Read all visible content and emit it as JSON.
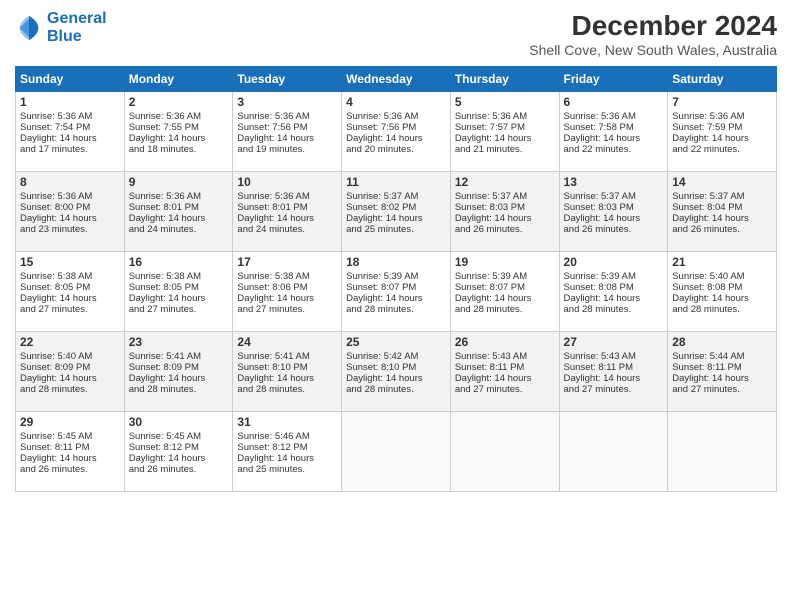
{
  "logo": {
    "line1": "General",
    "line2": "Blue"
  },
  "title": "December 2024",
  "subtitle": "Shell Cove, New South Wales, Australia",
  "headers": [
    "Sunday",
    "Monday",
    "Tuesday",
    "Wednesday",
    "Thursday",
    "Friday",
    "Saturday"
  ],
  "weeks": [
    [
      {
        "day": "1",
        "sunrise": "5:36 AM",
        "sunset": "7:54 PM",
        "daylight": "14 hours and 17 minutes."
      },
      {
        "day": "2",
        "sunrise": "5:36 AM",
        "sunset": "7:55 PM",
        "daylight": "14 hours and 18 minutes."
      },
      {
        "day": "3",
        "sunrise": "5:36 AM",
        "sunset": "7:56 PM",
        "daylight": "14 hours and 19 minutes."
      },
      {
        "day": "4",
        "sunrise": "5:36 AM",
        "sunset": "7:56 PM",
        "daylight": "14 hours and 20 minutes."
      },
      {
        "day": "5",
        "sunrise": "5:36 AM",
        "sunset": "7:57 PM",
        "daylight": "14 hours and 21 minutes."
      },
      {
        "day": "6",
        "sunrise": "5:36 AM",
        "sunset": "7:58 PM",
        "daylight": "14 hours and 22 minutes."
      },
      {
        "day": "7",
        "sunrise": "5:36 AM",
        "sunset": "7:59 PM",
        "daylight": "14 hours and 22 minutes."
      }
    ],
    [
      {
        "day": "8",
        "sunrise": "5:36 AM",
        "sunset": "8:00 PM",
        "daylight": "14 hours and 23 minutes."
      },
      {
        "day": "9",
        "sunrise": "5:36 AM",
        "sunset": "8:01 PM",
        "daylight": "14 hours and 24 minutes."
      },
      {
        "day": "10",
        "sunrise": "5:36 AM",
        "sunset": "8:01 PM",
        "daylight": "14 hours and 24 minutes."
      },
      {
        "day": "11",
        "sunrise": "5:37 AM",
        "sunset": "8:02 PM",
        "daylight": "14 hours and 25 minutes."
      },
      {
        "day": "12",
        "sunrise": "5:37 AM",
        "sunset": "8:03 PM",
        "daylight": "14 hours and 26 minutes."
      },
      {
        "day": "13",
        "sunrise": "5:37 AM",
        "sunset": "8:03 PM",
        "daylight": "14 hours and 26 minutes."
      },
      {
        "day": "14",
        "sunrise": "5:37 AM",
        "sunset": "8:04 PM",
        "daylight": "14 hours and 26 minutes."
      }
    ],
    [
      {
        "day": "15",
        "sunrise": "5:38 AM",
        "sunset": "8:05 PM",
        "daylight": "14 hours and 27 minutes."
      },
      {
        "day": "16",
        "sunrise": "5:38 AM",
        "sunset": "8:05 PM",
        "daylight": "14 hours and 27 minutes."
      },
      {
        "day": "17",
        "sunrise": "5:38 AM",
        "sunset": "8:06 PM",
        "daylight": "14 hours and 27 minutes."
      },
      {
        "day": "18",
        "sunrise": "5:39 AM",
        "sunset": "8:07 PM",
        "daylight": "14 hours and 28 minutes."
      },
      {
        "day": "19",
        "sunrise": "5:39 AM",
        "sunset": "8:07 PM",
        "daylight": "14 hours and 28 minutes."
      },
      {
        "day": "20",
        "sunrise": "5:39 AM",
        "sunset": "8:08 PM",
        "daylight": "14 hours and 28 minutes."
      },
      {
        "day": "21",
        "sunrise": "5:40 AM",
        "sunset": "8:08 PM",
        "daylight": "14 hours and 28 minutes."
      }
    ],
    [
      {
        "day": "22",
        "sunrise": "5:40 AM",
        "sunset": "8:09 PM",
        "daylight": "14 hours and 28 minutes."
      },
      {
        "day": "23",
        "sunrise": "5:41 AM",
        "sunset": "8:09 PM",
        "daylight": "14 hours and 28 minutes."
      },
      {
        "day": "24",
        "sunrise": "5:41 AM",
        "sunset": "8:10 PM",
        "daylight": "14 hours and 28 minutes."
      },
      {
        "day": "25",
        "sunrise": "5:42 AM",
        "sunset": "8:10 PM",
        "daylight": "14 hours and 28 minutes."
      },
      {
        "day": "26",
        "sunrise": "5:43 AM",
        "sunset": "8:11 PM",
        "daylight": "14 hours and 27 minutes."
      },
      {
        "day": "27",
        "sunrise": "5:43 AM",
        "sunset": "8:11 PM",
        "daylight": "14 hours and 27 minutes."
      },
      {
        "day": "28",
        "sunrise": "5:44 AM",
        "sunset": "8:11 PM",
        "daylight": "14 hours and 27 minutes."
      }
    ],
    [
      {
        "day": "29",
        "sunrise": "5:45 AM",
        "sunset": "8:11 PM",
        "daylight": "14 hours and 26 minutes."
      },
      {
        "day": "30",
        "sunrise": "5:45 AM",
        "sunset": "8:12 PM",
        "daylight": "14 hours and 26 minutes."
      },
      {
        "day": "31",
        "sunrise": "5:46 AM",
        "sunset": "8:12 PM",
        "daylight": "14 hours and 25 minutes."
      },
      null,
      null,
      null,
      null
    ]
  ],
  "labels": {
    "sunrise": "Sunrise:",
    "sunset": "Sunset:",
    "daylight": "Daylight:"
  }
}
